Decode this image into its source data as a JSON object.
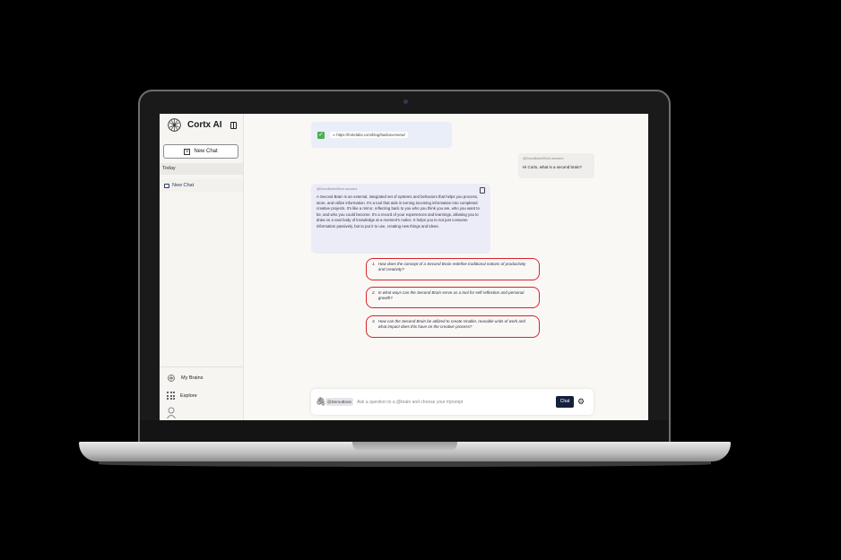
{
  "app": {
    "name": "Cortx AI"
  },
  "sidebar": {
    "new_chat_label": "New Chat",
    "section_today": "Today",
    "chat_items": [
      {
        "label": "New Chat"
      }
    ],
    "footer": {
      "my_brains": "My Brains",
      "explore": "Explore"
    }
  },
  "conversation": {
    "url_message": {
      "url": "https://fortelabs.com/blog/basboverview/"
    },
    "user_message": {
      "meta": "@DemoBrain#Short answers",
      "text": "Hi Cortx, what is a second brain?"
    },
    "answer": {
      "meta": "@DemoBrain#Short answers",
      "text": "A Second Brain is an external, integrated set of systems and behaviors that helps you process, store, and utilize information. It's a tool that aids in turning incoming information into completed creative projects. It's like a mirror, reflecting back to you who you think you are, who you want to be, and who you could become. It's a record of your experiences and learnings, allowing you to draw on a vast body of knowledge at a moment's notice. It helps you to not just consume information passively, but to put it to use, creating new things and ideas."
    },
    "suggested_questions": [
      {
        "num": "1.",
        "text": "How does the concept of a Second Brain redefine traditional notions of productivity and creativity?"
      },
      {
        "num": "2.",
        "text": "In what ways can the Second Brain serve as a tool for self-reflection and personal growth?"
      },
      {
        "num": "3.",
        "text": "How can the Second Brain be utilized to create smaller, reusable units of work and what impact does this have on the creative process?"
      }
    ]
  },
  "composer": {
    "brain_chip": "@DemoBrain",
    "placeholder": "Ask a question to a @brain and choose your #prompt",
    "send_label": "Chat"
  },
  "colors": {
    "accent_dark": "#14203d",
    "suggestion_border": "#d9232d",
    "answer_bg": "#ecebf8"
  }
}
